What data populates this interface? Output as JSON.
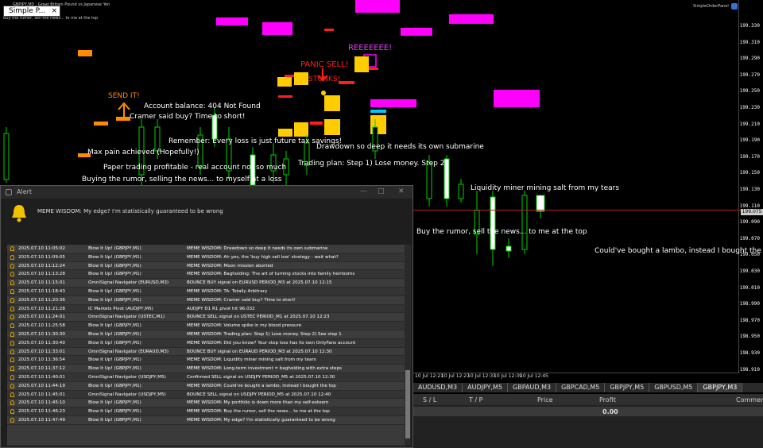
{
  "window": {
    "tab_label": "Simple P...",
    "symbol_line": "GBPJPY,M3 : Great Britain Pound vs Japanese Yen",
    "subline": "Buy the rumor, sell the news... to me at the top",
    "expert_name": "SimpleOrderPanel"
  },
  "price_axis": [
    "199.330",
    "199.310",
    "199.290",
    "199.270",
    "199.250",
    "199.230",
    "199.210",
    "199.190",
    "199.170",
    "199.150",
    "199.130",
    "199.110",
    "199.090",
    "199.070",
    "199.050",
    "199.030",
    "199.010",
    "198.990",
    "198.970",
    "198.950",
    "198.930",
    "198.910",
    "198.890"
  ],
  "current_price": "199.075",
  "time_axis": [
    "10 Jul 12:21",
    "10 Jul 12:27",
    "10 Jul 12:33",
    "10 Jul 12:39",
    "10 Jul 12:45"
  ],
  "chart_texts": {
    "reeee": "REEEEEEE!",
    "panic": "PANIC SELL!",
    "stonks": "STONKS!",
    "send_it": "SEND IT!",
    "balance": "Account balance: 404 Not Found",
    "cramer": "Cramer said buy? Time to short!",
    "stoploss": "Remember: Every loss is just future tax savings!",
    "drawdown": "Drawdown so deep it needs its own submarine",
    "max_pain": "Max pain achieved (Hopefully!)",
    "trading_plan": "Trading plan: Step 1) Lose money. Step 2)",
    "paper": "Paper trading profitable - real account not so much",
    "buying": "Buying the rumor, selling the news... to myself at a loss",
    "liquidity": "Liquidity miner mining salt from my tears",
    "buy_rumor": "Buy the rumor, sell the news... to me at the top",
    "lambo": "Could've bought a lambo, instead I bought the top"
  },
  "symbol_tabs": [
    "AUDUSD,M3",
    "AUDJPY,M5",
    "GBPAUD,M3",
    "GBPCAD,M5",
    "GBPJPY,M5",
    "GBPUSD,M5",
    "GBPJPY,M3"
  ],
  "trade_panel": {
    "headers": [
      "S / L",
      "T / P",
      "Price",
      "Profit",
      "Comment"
    ],
    "profit_value": "0.00"
  },
  "alert": {
    "title": "Alert",
    "message": "MEME WISDOM: My edge? I'm statistically guaranteed to be wrong",
    "rows": [
      [
        "2025.07.10 11:05:02",
        "Blow It Up! (GBPJPY,M1)",
        "MEME WISDOM: Drawdown so deep it needs its own submarine"
      ],
      [
        "2025.07.10 11:09:05",
        "Blow It Up! (GBPJPY,M1)",
        "MEME WISDOM: Ah yes, the 'buy high sell low' strategy - wait what?"
      ],
      [
        "2025.07.10 11:12:24",
        "Blow It Up! (GBPJPY,M1)",
        "MEME WISDOM: Moon mission aborted"
      ],
      [
        "2025.07.10 11:13:28",
        "Blow It Up! (GBPJPY,M1)",
        "MEME WISDOM: Bagholding: The art of turning stocks into family heirlooms"
      ],
      [
        "2025.07.10 11:15:01",
        "OmniSignal Navigator (EURUSD,M3)",
        "BOUNCE BUY signal on EURUSD PERIOD_M3 at 2025.07.10 12:15"
      ],
      [
        "2025.07.10 11:18:43",
        "Blow It Up! (GBPJPY,M1)",
        "MEME WISDOM: TA: Totally Arbitrary"
      ],
      [
        "2025.07.10 11:20:36",
        "Blow It Up! (GBPJPY,M1)",
        "MEME WISDOM: Cramer said buy? Time to short!"
      ],
      [
        "2025.07.10 11:21:28",
        "IC Markets Pivot (AUDJPY,M5)",
        "AUDJPY D1 R1 pivot hit 96.032"
      ],
      [
        "2025.07.10 11:24:01",
        "OmniSignal Navigator (USTEC,M1)",
        "BOUNCE SELL signal on USTEC PERIOD_M1 at 2025.07.10 12:23"
      ],
      [
        "2025.07.10 11:25:58",
        "Blow It Up! (GBPJPY,M1)",
        "MEME WISDOM: Volume spike in my blood pressure"
      ],
      [
        "2025.07.10 11:30:30",
        "Blow It Up! (GBPJPY,M1)",
        "MEME WISDOM: Trading plan: Step 1) Lose money. Step 2) See step 1."
      ],
      [
        "2025.07.10 11:30:40",
        "Blow It Up! (GBPJPY,M1)",
        "MEME WISDOM: Did you know? Your stop loss has its own OnlyFans account"
      ],
      [
        "2025.07.10 11:33:01",
        "OmniSignal Navigator (EURAUD,M3)",
        "BOUNCE BUY signal on EURAUD PERIOD_M3 at 2025.07.10 12:30"
      ],
      [
        "2025.07.10 11:36:54",
        "Blow It Up! (GBPJPY,M1)",
        "MEME WISDOM: Liquidity miner mining salt from my tears"
      ],
      [
        "2025.07.10 11:37:12",
        "Blow It Up! (GBPJPY,M1)",
        "MEME WISDOM: Long-term investment = bagholding with extra steps"
      ],
      [
        "2025.07.10 11:40:01",
        "OmniSignal Navigator (USDJPY,M5)",
        "Confirmed SELL signal on USDJPY PERIOD_M5 at 2025.07.10 12:30"
      ],
      [
        "2025.07.10 11:44:19",
        "Blow It Up! (GBPJPY,M1)",
        "MEME WISDOM: Could've bought a lambo, instead I bought the top"
      ],
      [
        "2025.07.10 11:45:01",
        "OmniSignal Navigator (USDJPY,M5)",
        "BOUNCE SELL signal on USDJPY PERIOD_M5 at 2025.07.10 12:40"
      ],
      [
        "2025.07.10 11:45:10",
        "Blow It Up! (GBPJPY,M1)",
        "MEME WISDOM: My portfolio is down more than my self-esteem"
      ],
      [
        "2025.07.10 11:46:23",
        "Blow It Up! (GBPJPY,M1)",
        "MEME WISDOM: Buy the rumor, sell the news... to me at the top"
      ],
      [
        "2025.07.10 11:47:49",
        "Blow It Up! (GBPJPY,M1)",
        "MEME WISDOM: My edge? I'm statistically guaranteed to be wrong"
      ]
    ]
  }
}
